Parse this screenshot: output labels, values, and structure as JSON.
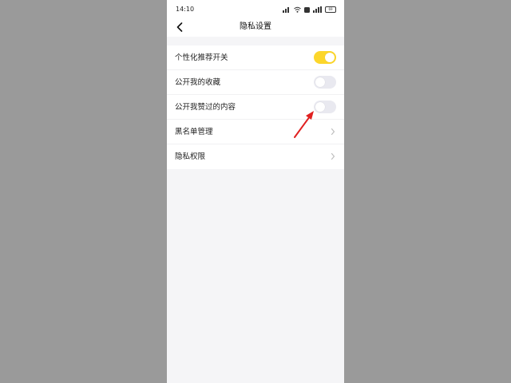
{
  "status_bar": {
    "time": "14:10",
    "battery": "69"
  },
  "header": {
    "title": "隐私设置"
  },
  "settings": [
    {
      "label": "个性化推荐开关",
      "kind": "toggle",
      "on": true
    },
    {
      "label": "公开我的收藏",
      "kind": "toggle",
      "on": false
    },
    {
      "label": "公开我赞过的内容",
      "kind": "toggle",
      "on": false
    },
    {
      "label": "黑名单管理",
      "kind": "link"
    },
    {
      "label": "隐私权限",
      "kind": "link"
    }
  ],
  "colors": {
    "toggle_on": "#fcd62b",
    "toggle_off": "#e9e9f0",
    "annotation_arrow": "#e02020"
  },
  "icons": {
    "back": "chevron-left-icon",
    "row_link": "chevron-right-icon"
  }
}
